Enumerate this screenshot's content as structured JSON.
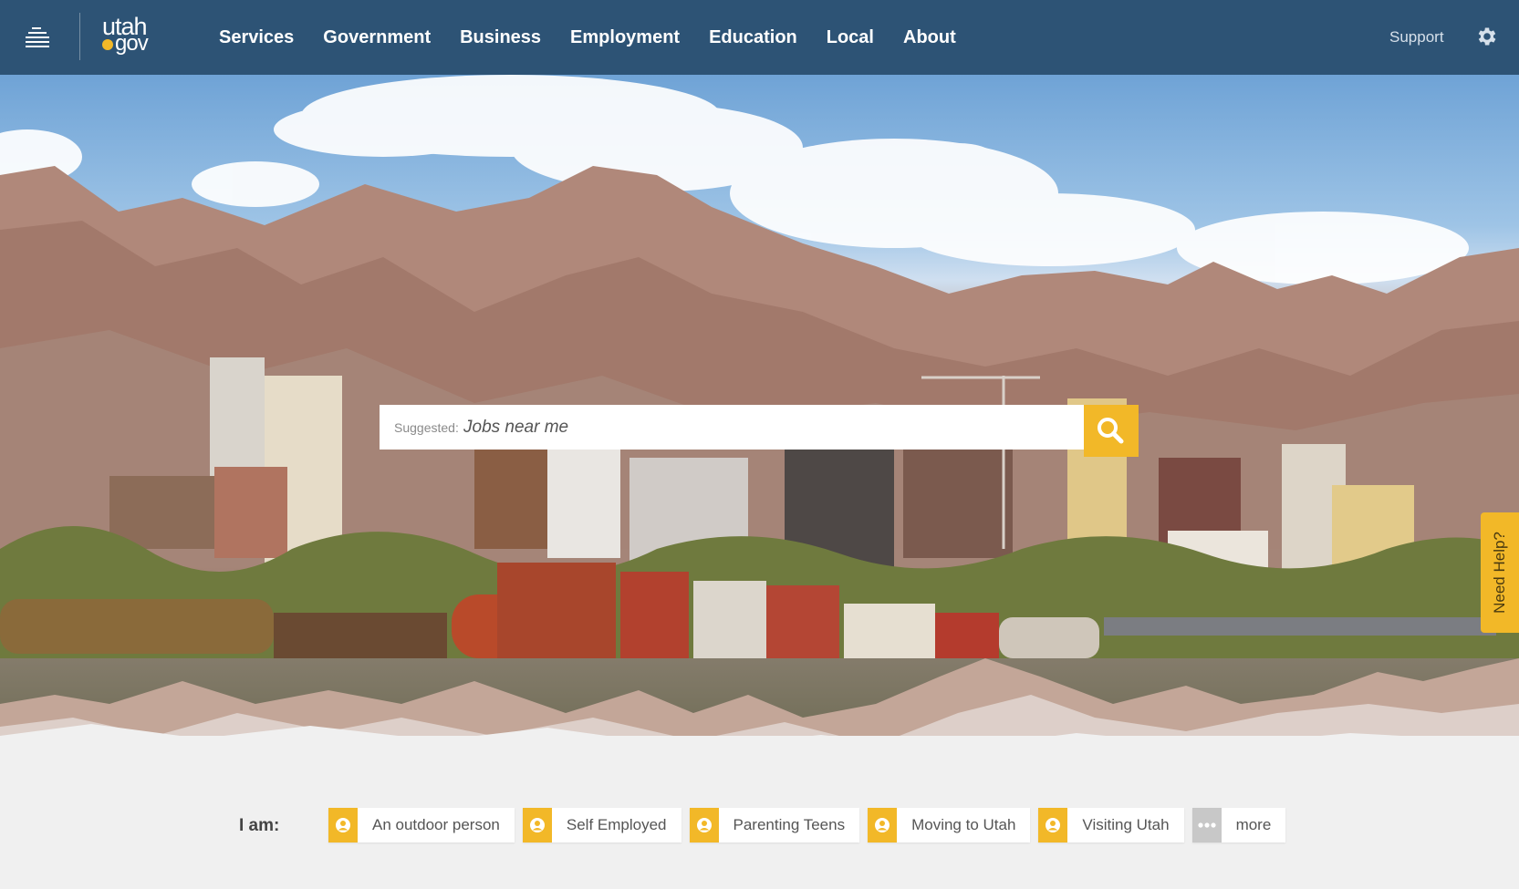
{
  "header": {
    "logo_top": "utah",
    "logo_bottom": "gov",
    "nav": [
      "Services",
      "Government",
      "Business",
      "Employment",
      "Education",
      "Local",
      "About"
    ],
    "support": "Support",
    "settings_icon": "gear-icon",
    "menu_icon": "menu-icon"
  },
  "search": {
    "label": "Suggested:",
    "placeholder": "Jobs near me",
    "button_icon": "search-icon"
  },
  "help_tab": "Need Help?",
  "iam": {
    "label": "I am:",
    "chips": [
      {
        "label": "An outdoor person",
        "icon": "person-icon"
      },
      {
        "label": "Self Employed",
        "icon": "person-icon"
      },
      {
        "label": "Parenting Teens",
        "icon": "person-icon"
      },
      {
        "label": "Moving to Utah",
        "icon": "person-icon"
      },
      {
        "label": "Visiting Utah",
        "icon": "person-icon"
      },
      {
        "label": "more",
        "icon": "ellipsis-icon"
      }
    ]
  },
  "colors": {
    "header_bg": "#2d5375",
    "accent": "#f2b828",
    "page_bg": "#f0f0f0"
  }
}
